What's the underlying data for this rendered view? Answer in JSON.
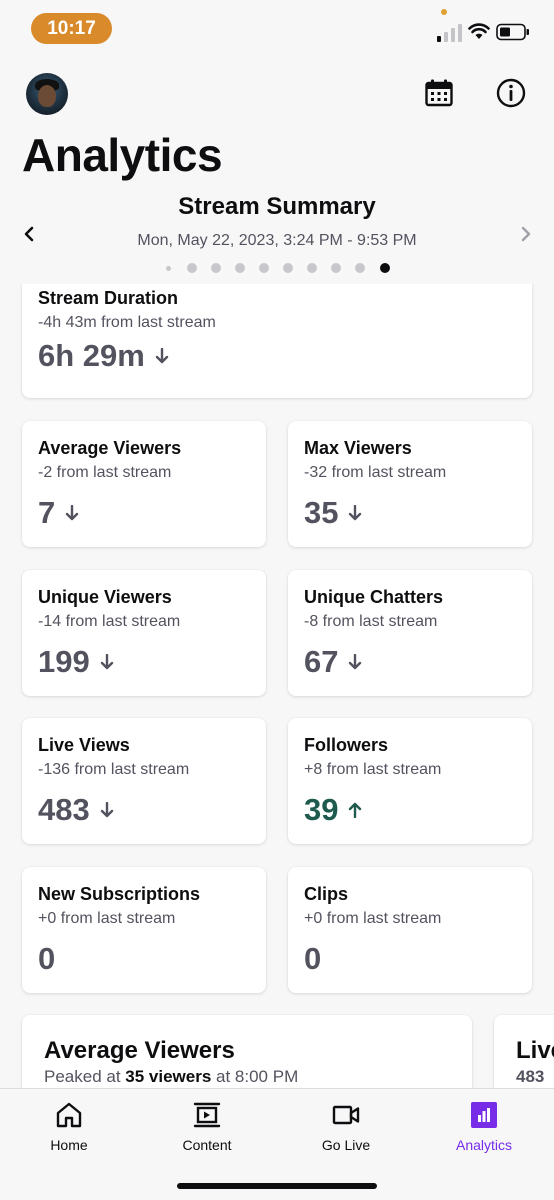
{
  "status_bar": {
    "time": "10:17"
  },
  "header": {
    "title": "Analytics"
  },
  "summary": {
    "title": "Stream Summary",
    "date_range": "Mon, May 22, 2023, 3:24 PM - 9:53 PM",
    "page_count": 10,
    "active_page": 9
  },
  "stats": {
    "stream_duration": {
      "label": "Stream Duration",
      "delta": "-4h 43m from last stream",
      "value": "6h 29m",
      "trend": "down"
    },
    "average_viewers": {
      "label": "Average Viewers",
      "delta": "-2 from last stream",
      "value": "7",
      "trend": "down"
    },
    "max_viewers": {
      "label": "Max Viewers",
      "delta": "-32 from last stream",
      "value": "35",
      "trend": "down"
    },
    "unique_viewers": {
      "label": "Unique Viewers",
      "delta": "-14 from last stream",
      "value": "199",
      "trend": "down"
    },
    "unique_chatters": {
      "label": "Unique Chatters",
      "delta": "-8 from last stream",
      "value": "67",
      "trend": "down"
    },
    "live_views": {
      "label": "Live Views",
      "delta": "-136 from last stream",
      "value": "483",
      "trend": "down"
    },
    "followers": {
      "label": "Followers",
      "delta": "+8 from last stream",
      "value": "39",
      "trend": "up"
    },
    "new_subscriptions": {
      "label": "New Subscriptions",
      "delta": "+0 from last stream",
      "value": "0",
      "trend": "none"
    },
    "clips": {
      "label": "Clips",
      "delta": "+0 from last stream",
      "value": "0",
      "trend": "none"
    }
  },
  "chart_cards": [
    {
      "title": "Average Viewers",
      "sub_prefix": "Peaked at ",
      "sub_bold": "35 viewers",
      "sub_suffix": " at 8:00 PM"
    },
    {
      "title": "Live",
      "sub": "483"
    }
  ],
  "tabs": [
    {
      "label": "Home",
      "icon": "home-icon"
    },
    {
      "label": "Content",
      "icon": "film-icon"
    },
    {
      "label": "Go Live",
      "icon": "video-camera-icon"
    },
    {
      "label": "Analytics",
      "icon": "analytics-icon",
      "active": true
    }
  ],
  "colors": {
    "accent": "#772ce8",
    "up": "#1e5a4e",
    "time_pill": "#d98a2b"
  }
}
